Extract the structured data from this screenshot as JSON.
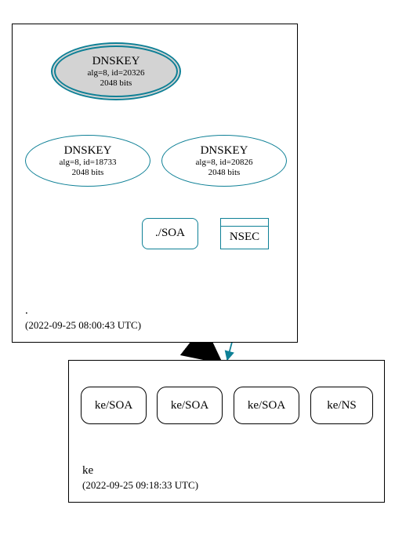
{
  "zones": {
    "root": {
      "label": ".",
      "timestamp": "(2022-09-25 08:00:43 UTC)"
    },
    "ke": {
      "label": "ke",
      "timestamp": "(2022-09-25 09:18:33 UTC)"
    }
  },
  "nodes": {
    "ksk": {
      "title": "DNSKEY",
      "sub1": "alg=8, id=20326",
      "sub2": "2048 bits"
    },
    "zsk_a": {
      "title": "DNSKEY",
      "sub1": "alg=8, id=18733",
      "sub2": "2048 bits"
    },
    "zsk_b": {
      "title": "DNSKEY",
      "sub1": "alg=8, id=20826",
      "sub2": "2048 bits"
    },
    "soa": {
      "label": "./SOA"
    },
    "nsec": {
      "label": "NSEC"
    }
  },
  "records": {
    "r1": "ke/SOA",
    "r2": "ke/SOA",
    "r3": "ke/SOA",
    "r4": "ke/NS"
  }
}
